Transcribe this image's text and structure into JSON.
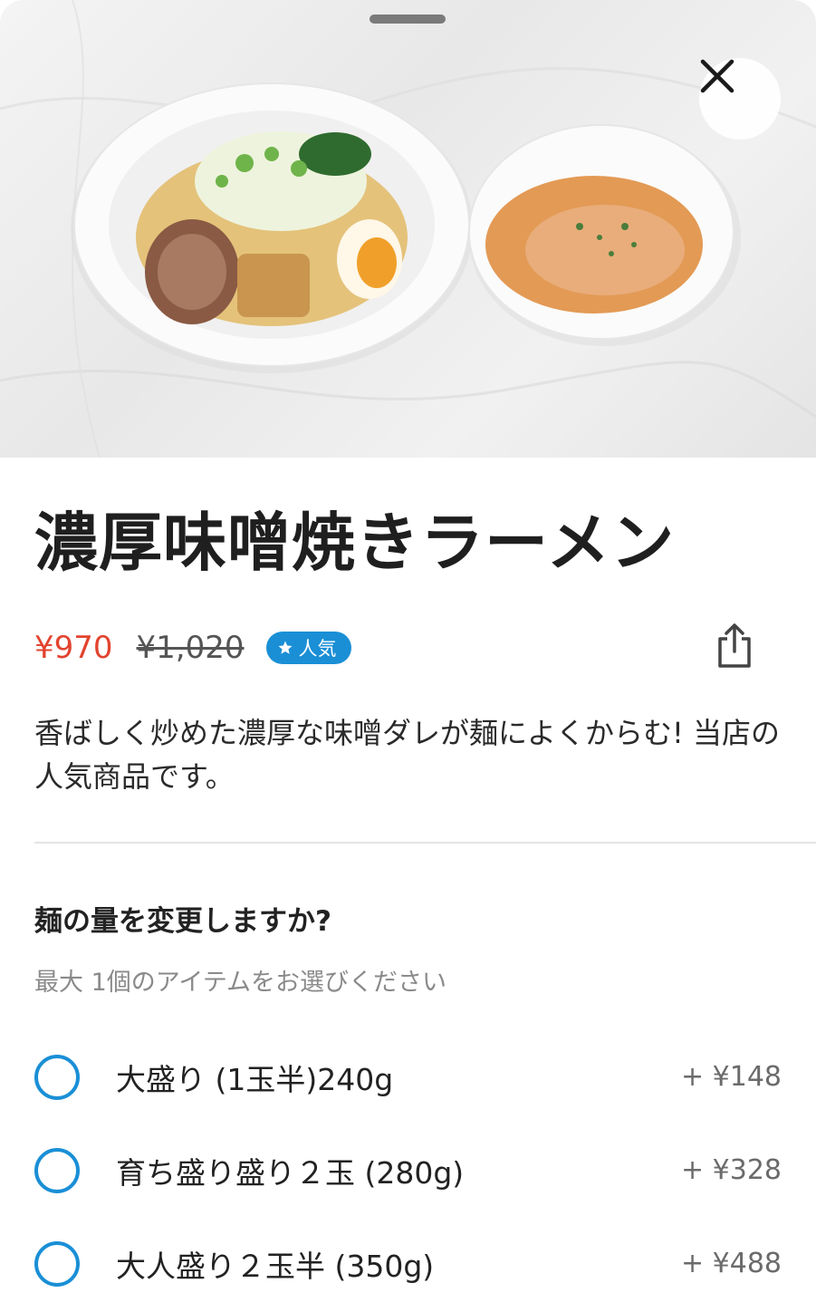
{
  "hero": {
    "photo_icon": "ramen-photo",
    "close_icon": "close-icon"
  },
  "item": {
    "title": "濃厚味噌焼きラーメン",
    "price": "¥970",
    "original_price": "¥1,020",
    "badge_icon": "star-icon",
    "badge_label": "人気",
    "share_icon": "share-icon",
    "description": "香ばしく炒めた濃厚な味噌ダレが麺によくからむ! 当店の人気商品です。"
  },
  "colors": {
    "price": "#e2442f",
    "accent": "#1a8fd6"
  },
  "options_section": {
    "title": "麺の量を変更しますか?",
    "subtitle": "最大 1個のアイテムをお選びください",
    "options": [
      {
        "label": "大盛り (1玉半)240g",
        "price": "+ ¥148"
      },
      {
        "label": "育ち盛り盛り２玉 (280g)",
        "price": "+ ¥328"
      },
      {
        "label": "大人盛り２玉半 (350g)",
        "price": "+ ¥488"
      }
    ]
  }
}
